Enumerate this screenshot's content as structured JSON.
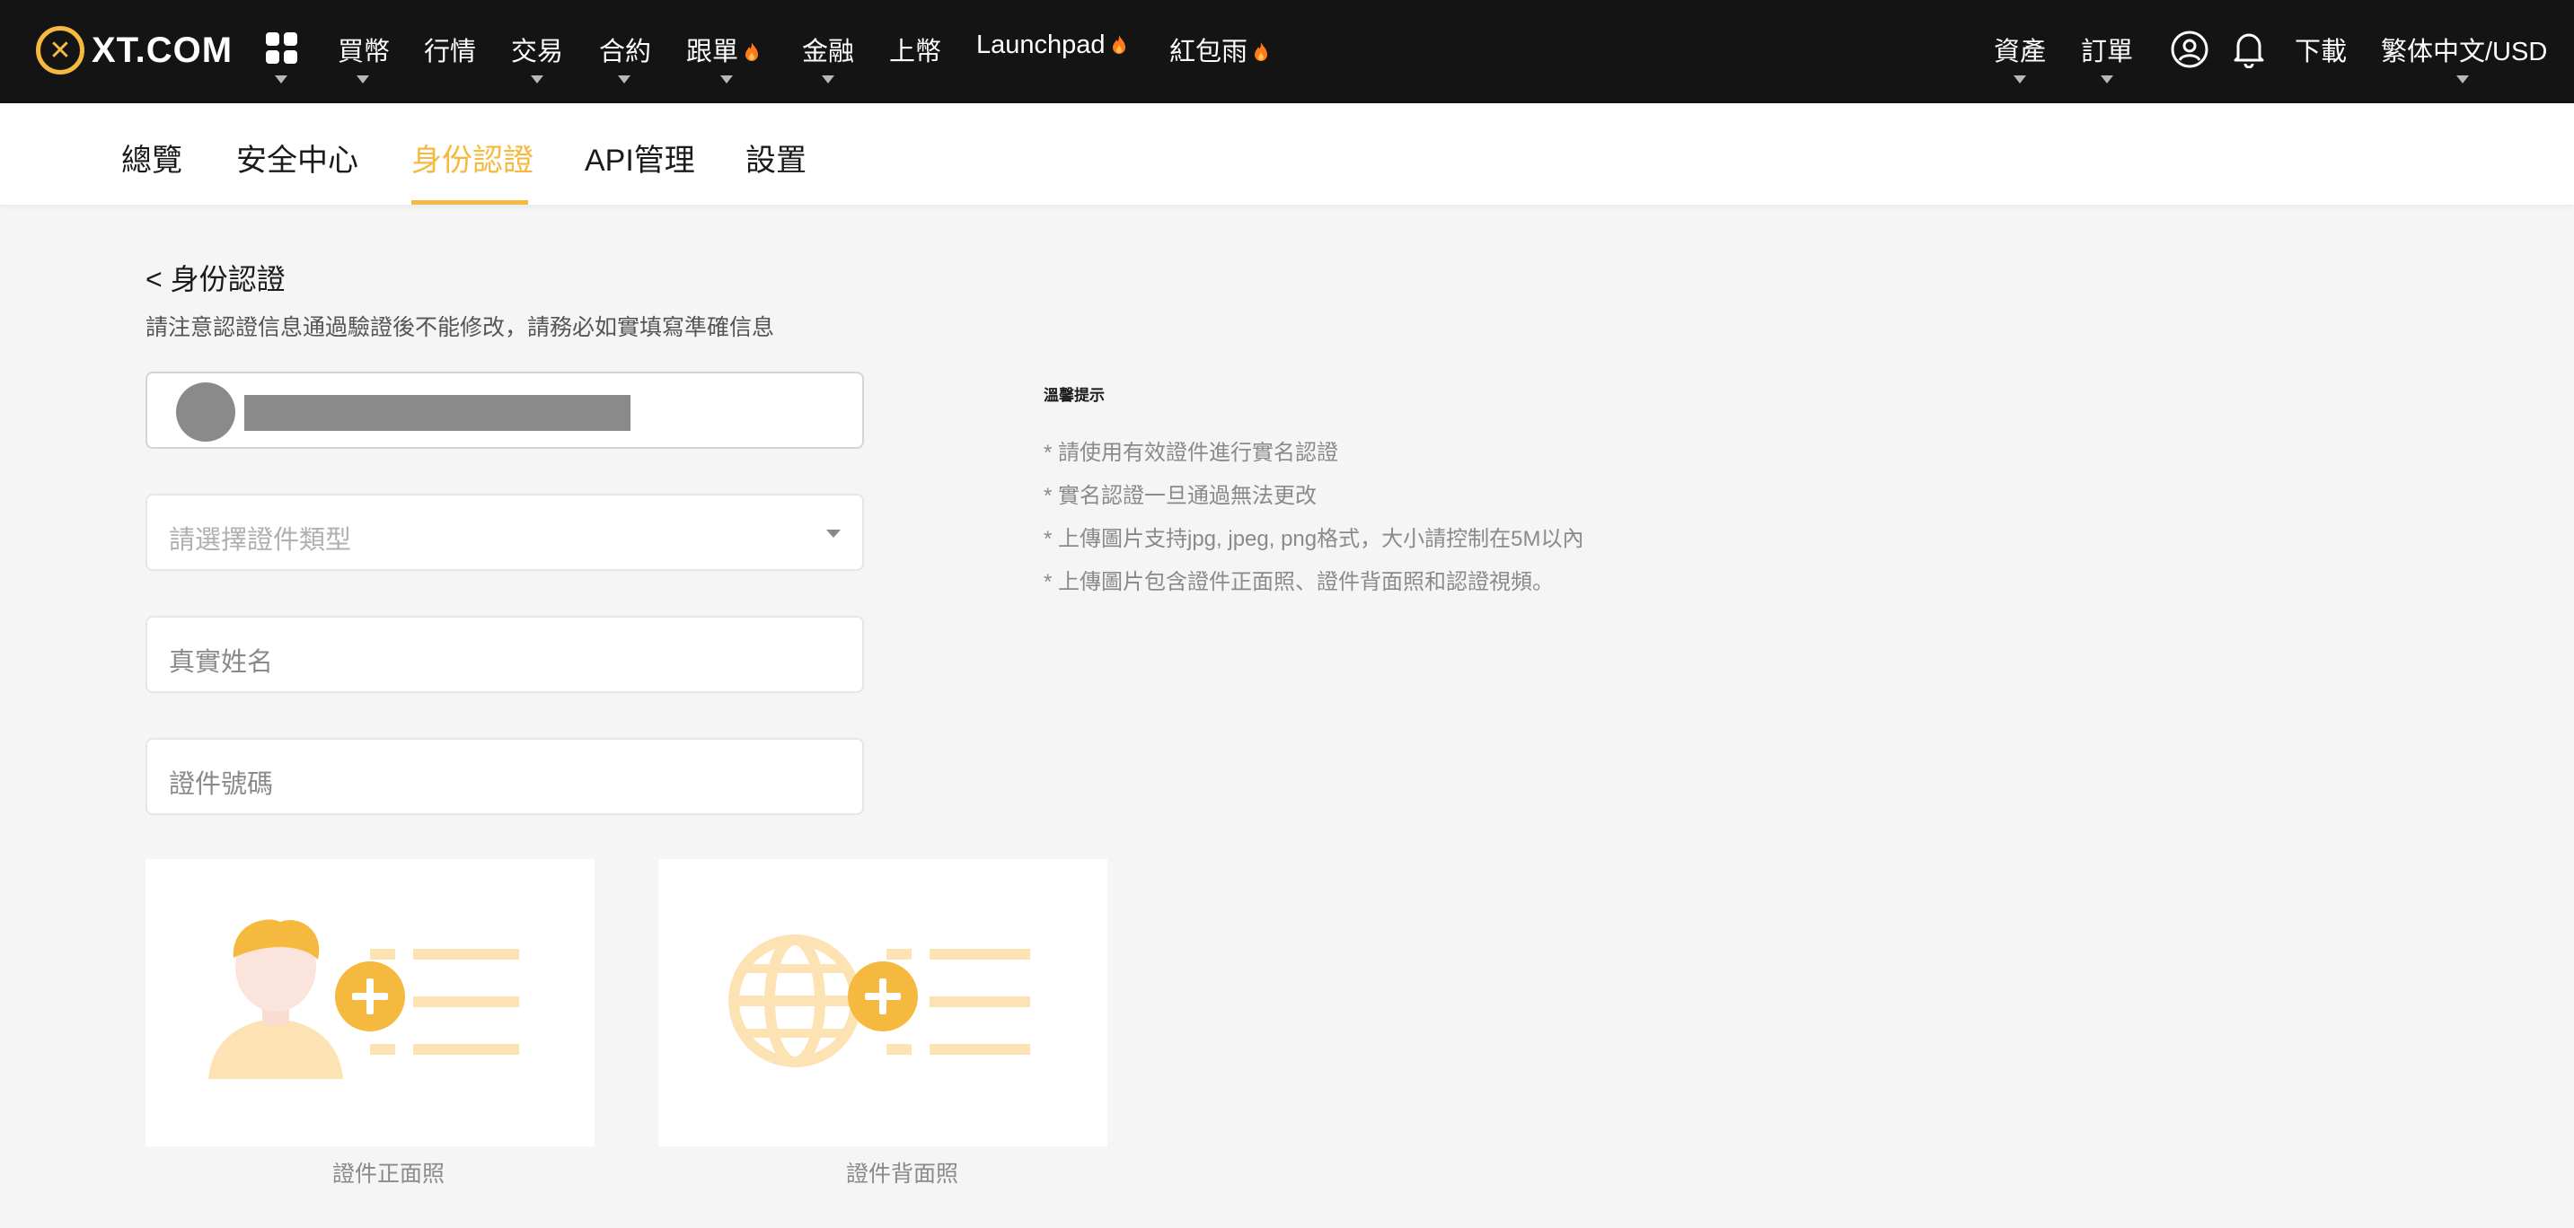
{
  "brand": {
    "logo_text": "XT.COM",
    "accent": "#f5b93f",
    "nav_bg": "#141414"
  },
  "topnav": {
    "items": [
      {
        "label": "買幣"
      },
      {
        "label": "行情"
      },
      {
        "label": "交易"
      },
      {
        "label": "合約"
      },
      {
        "label": "跟單"
      },
      {
        "label": "金融"
      },
      {
        "label": "上幣"
      },
      {
        "label": "Launchpad"
      },
      {
        "label": "紅包雨"
      }
    ],
    "right": {
      "assets": "資產",
      "orders": "訂單",
      "download": "下載",
      "locale": "繁体中文/USD"
    },
    "icons": [
      "apps-grid-icon",
      "fire-icon",
      "user-circle-icon",
      "bell-icon",
      "chevron-down-icon"
    ]
  },
  "subnav": {
    "tabs": [
      {
        "label": "總覽"
      },
      {
        "label": "安全中心"
      },
      {
        "label": "身份認證",
        "active": true
      },
      {
        "label": "API管理"
      },
      {
        "label": "設置"
      }
    ]
  },
  "page": {
    "title": "< 身份認證",
    "notice": "請注意認證信息通過驗證後不能修改，請務必如實填寫準確信息"
  },
  "form": {
    "id_type_placeholder": "請選擇證件類型",
    "real_name_placeholder": "真實姓名",
    "id_number_placeholder": "證件號碼",
    "upload_front_label": "證件正面照",
    "upload_back_label": "證件背面照"
  },
  "tips": {
    "title": "溫馨提示",
    "items": [
      "* 請使用有效證件進行實名認證",
      "* 實名認證一旦通過無法更改",
      "* 上傳圖片支持jpg, jpeg, png格式，大小請控制在5M以內",
      "* 上傳圖片包含證件正面照、證件背面照和認證視頻。"
    ]
  }
}
